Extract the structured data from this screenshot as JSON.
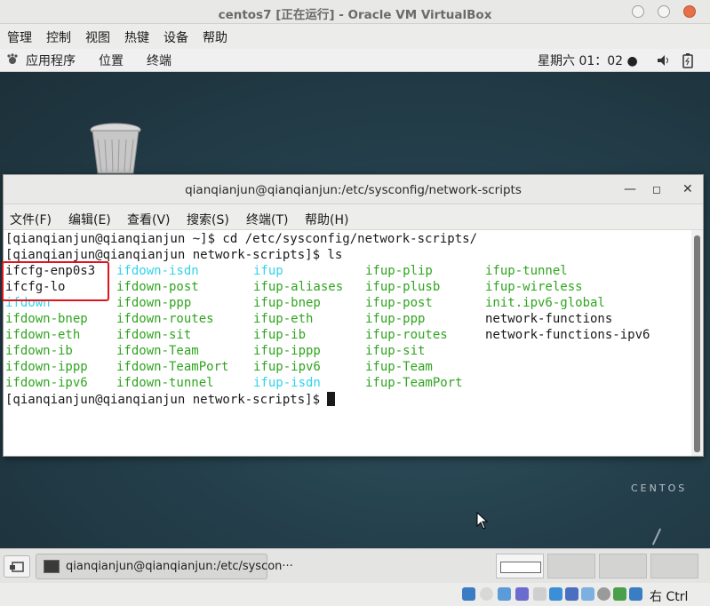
{
  "vbox": {
    "title": "centos7 [正在运行] - Oracle VM VirtualBox",
    "menu": [
      "管理",
      "控制",
      "视图",
      "热键",
      "设备",
      "帮助"
    ],
    "host_key": "右 Ctrl"
  },
  "gnome": {
    "applications": "应用程序",
    "places": "位置",
    "terminal": "终端",
    "clock": "星期六 01：02 ●"
  },
  "desktop": {
    "brand": "CENTOS"
  },
  "terminal": {
    "title": "qianqianjun@qianqianjun:/etc/sysconfig/network-scripts",
    "menu": [
      "文件(F)",
      "编辑(E)",
      "查看(V)",
      "搜索(S)",
      "终端(T)",
      "帮助(H)"
    ],
    "lines": [
      "[qianqianjun@qianqianjun ~]$ cd /etc/sysconfig/network-scripts/",
      "[qianqianjun@qianqianjun network-scripts]$ ls"
    ],
    "ls_columns": [
      [
        {
          "t": "ifcfg-enp0s3",
          "c": "dark"
        },
        {
          "t": "ifcfg-lo",
          "c": "dark"
        },
        {
          "t": "ifdown",
          "c": "cyan"
        },
        {
          "t": "ifdown-bnep",
          "c": "green"
        },
        {
          "t": "ifdown-eth",
          "c": "green"
        },
        {
          "t": "ifdown-ib",
          "c": "green"
        },
        {
          "t": "ifdown-ippp",
          "c": "green"
        },
        {
          "t": "ifdown-ipv6",
          "c": "green"
        }
      ],
      [
        {
          "t": "ifdown-isdn",
          "c": "cyan"
        },
        {
          "t": "ifdown-post",
          "c": "green"
        },
        {
          "t": "ifdown-ppp",
          "c": "green"
        },
        {
          "t": "ifdown-routes",
          "c": "green"
        },
        {
          "t": "ifdown-sit",
          "c": "green"
        },
        {
          "t": "ifdown-Team",
          "c": "green"
        },
        {
          "t": "ifdown-TeamPort",
          "c": "green"
        },
        {
          "t": "ifdown-tunnel",
          "c": "green"
        }
      ],
      [
        {
          "t": "ifup",
          "c": "cyan"
        },
        {
          "t": "ifup-aliases",
          "c": "green"
        },
        {
          "t": "ifup-bnep",
          "c": "green"
        },
        {
          "t": "ifup-eth",
          "c": "green"
        },
        {
          "t": "ifup-ib",
          "c": "green"
        },
        {
          "t": "ifup-ippp",
          "c": "green"
        },
        {
          "t": "ifup-ipv6",
          "c": "green"
        },
        {
          "t": "ifup-isdn",
          "c": "cyan"
        }
      ],
      [
        {
          "t": "ifup-plip",
          "c": "green"
        },
        {
          "t": "ifup-plusb",
          "c": "green"
        },
        {
          "t": "ifup-post",
          "c": "green"
        },
        {
          "t": "ifup-ppp",
          "c": "green"
        },
        {
          "t": "ifup-routes",
          "c": "green"
        },
        {
          "t": "ifup-sit",
          "c": "green"
        },
        {
          "t": "ifup-Team",
          "c": "green"
        },
        {
          "t": "ifup-TeamPort",
          "c": "green"
        }
      ],
      [
        {
          "t": "ifup-tunnel",
          "c": "green"
        },
        {
          "t": "ifup-wireless",
          "c": "green"
        },
        {
          "t": "init.ipv6-global",
          "c": "green"
        },
        {
          "t": "network-functions",
          "c": "dark"
        },
        {
          "t": "network-functions-ipv6",
          "c": "dark"
        }
      ]
    ],
    "final_prompt": "[qianqianjun@qianqianjun network-scripts]$ "
  },
  "taskbar": {
    "task_label": "qianqianjun@qianqianjun:/etc/syscon···"
  },
  "colors": {
    "ls_exec": "#2fa51f",
    "ls_link": "#2fd4e8",
    "highlight_box": "#e0141e"
  }
}
